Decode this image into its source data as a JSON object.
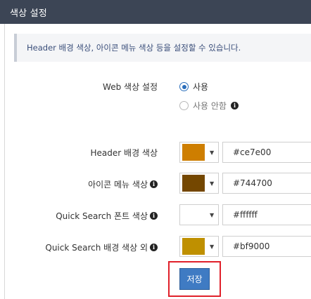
{
  "panel": {
    "title": "색상 설정"
  },
  "notice": "Header 배경 색상, 아이콘 메뉴 색상 등을 설정할 수 있습니다.",
  "web_color": {
    "label": "Web 색상 설정",
    "options": [
      {
        "label": "사용",
        "checked": true
      },
      {
        "label": "사용 안함",
        "checked": false
      }
    ]
  },
  "colors": [
    {
      "label": "Header 배경 색상",
      "info": false,
      "value": "#ce7e00",
      "swatch": "#ce7e00"
    },
    {
      "label": "아이콘 메뉴 색상",
      "info": true,
      "value": "#744700",
      "swatch": "#744700"
    },
    {
      "label": "Quick Search 폰트 색상",
      "info": true,
      "value": "#ffffff",
      "swatch": "#ffffff"
    },
    {
      "label": "Quick Search 배경 색상 외",
      "info": true,
      "value": "#bf9000",
      "swatch": "#bf9000"
    }
  ],
  "save_label": "저장",
  "highlight_color": "#e0202a",
  "accent_color": "#3f7bc3"
}
